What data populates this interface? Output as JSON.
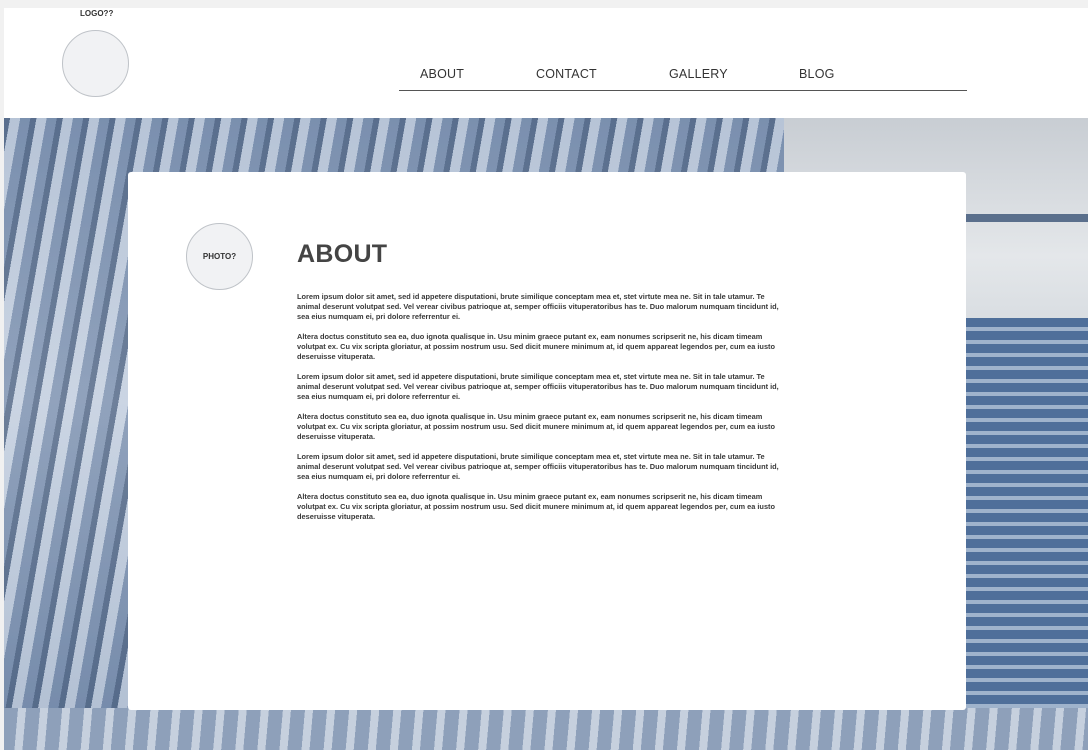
{
  "header": {
    "logo_label": "LOGO??",
    "nav": [
      {
        "label": "ABOUT"
      },
      {
        "label": "CONTACT"
      },
      {
        "label": "GALLERY"
      },
      {
        "label": "BLOG"
      }
    ]
  },
  "main": {
    "photo_label": "PHOTO?",
    "title": "ABOUT",
    "paragraphs": [
      "Lorem ipsum dolor sit amet, sed id appetere disputationi, brute similique conceptam mea et, stet virtute mea ne. Sit in tale utamur. Te animal deserunt volutpat sed. Vel verear civibus patrioque at, semper officiis vituperatoribus has te. Duo malorum numquam tincidunt id, sea eius numquam ei, pri dolore referrentur ei.",
      "Altera doctus constituto sea ea, duo ignota qualisque in. Usu minim graece putant ex, eam nonumes scripserit ne, his dicam timeam volutpat ex. Cu vix scripta gloriatur, at possim nostrum usu. Sed dicit munere minimum at, id quem appareat legendos per, cum ea iusto deseruisse vituperata.",
      "Lorem ipsum dolor sit amet, sed id appetere disputationi, brute similique conceptam mea et, stet virtute mea ne. Sit in tale utamur. Te animal deserunt volutpat sed. Vel verear civibus patrioque at, semper officiis vituperatoribus has te. Duo malorum numquam tincidunt id, sea eius numquam ei, pri dolore referrentur ei.",
      "Altera doctus constituto sea ea, duo ignota qualisque in. Usu minim graece putant ex, eam nonumes scripserit ne, his dicam timeam volutpat ex. Cu vix scripta gloriatur, at possim nostrum usu. Sed dicit munere minimum at, id quem appareat legendos per, cum ea iusto deseruisse vituperata.",
      "Lorem ipsum dolor sit amet, sed id appetere disputationi, brute similique conceptam mea et, stet virtute mea ne. Sit in tale utamur. Te animal deserunt volutpat sed. Vel verear civibus patrioque at, semper officiis vituperatoribus has te. Duo malorum numquam tincidunt id, sea eius numquam ei, pri dolore referrentur ei.",
      "Altera doctus constituto sea ea, duo ignota qualisque in. Usu minim graece putant ex, eam nonumes scripserit ne, his dicam timeam volutpat ex. Cu vix scripta gloriatur, at possim nostrum usu. Sed dicit munere minimum at, id quem appareat legendos per, cum ea iusto deseruisse vituperata."
    ]
  },
  "colors": {
    "page_background": "#f1f1f1",
    "header_background": "#ffffff",
    "card_background": "#ffffff",
    "text": "#333333",
    "placeholder_circle": "#f1f2f4",
    "hero_tint": "#7d93b3"
  }
}
